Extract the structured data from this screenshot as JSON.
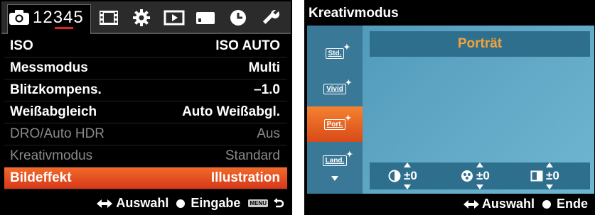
{
  "left": {
    "tabs": {
      "numbers": "12345",
      "active_page": "3"
    },
    "rows": [
      {
        "label": "ISO",
        "value": "ISO AUTO",
        "state": "normal"
      },
      {
        "label": "Messmodus",
        "value": "Multi",
        "state": "normal"
      },
      {
        "label": "Blitzkompens.",
        "value": "–1.0",
        "state": "normal"
      },
      {
        "label": "Weißabgleich",
        "value": "Auto Weißabgl.",
        "state": "normal"
      },
      {
        "label": "DRO/Auto HDR",
        "value": "Aus",
        "state": "dim"
      },
      {
        "label": "Kreativmodus",
        "value": "Standard",
        "state": "dim"
      },
      {
        "label": "Bildeffekt",
        "value": "Illustration",
        "state": "selected"
      }
    ],
    "footer": {
      "select": "Auswahl",
      "enter": "Eingabe",
      "menu_badge": "MENU"
    }
  },
  "right": {
    "title": "Kreativmodus",
    "selected_style": "Porträt",
    "styles": [
      {
        "code": "Std.",
        "selected": false
      },
      {
        "code": "Vivid",
        "selected": false
      },
      {
        "code": "Port.",
        "selected": true
      },
      {
        "code": "Land.",
        "selected": false
      }
    ],
    "params": [
      {
        "icon": "contrast-icon",
        "value": "±0"
      },
      {
        "icon": "saturation-icon",
        "value": "±0"
      },
      {
        "icon": "sharpness-icon",
        "value": "±0"
      }
    ],
    "footer": {
      "select": "Auswahl",
      "end": "Ende"
    }
  },
  "colors": {
    "accent": "#e0271a",
    "selected_row": "#e8501f",
    "panel": "#5aa6c5",
    "highlight_text": "#f5a23a"
  }
}
